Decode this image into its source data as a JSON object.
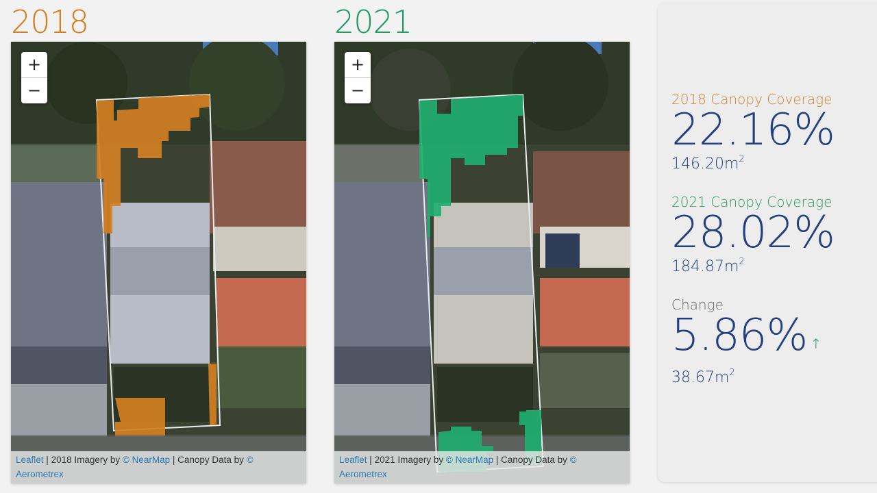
{
  "maps": [
    {
      "year": "2018",
      "accent": "#d27f22",
      "zoom_in": "+",
      "zoom_out": "−",
      "attribution": {
        "leaflet": "Leaflet",
        "sep1": " | ",
        "imagery_text": "2018 Imagery by ",
        "nearmap": "© NearMap",
        "sep2": " | Canopy Data by ",
        "aerometrex": "© Aerometrex"
      }
    },
    {
      "year": "2021",
      "accent": "#1f9a64",
      "zoom_in": "+",
      "zoom_out": "−",
      "attribution": {
        "leaflet": "Leaflet",
        "sep1": " | ",
        "imagery_text": "2021 Imagery by ",
        "nearmap": "© NearMap",
        "sep2": " | Canopy Data by ",
        "aerometrex": "© Aerometrex"
      }
    }
  ],
  "stats": {
    "coverage_2018": {
      "label": "2018 Canopy Coverage",
      "percent": "22.16%",
      "area": "146.20m",
      "unit_sup": "2"
    },
    "coverage_2021": {
      "label": "2021 Canopy Coverage",
      "percent": "28.02%",
      "area": "184.87m",
      "unit_sup": "2"
    },
    "change": {
      "label": "Change",
      "percent": "5.86%",
      "direction_icon": "↑",
      "area": "38.67m",
      "unit_sup": "2"
    }
  },
  "colors": {
    "canopy_2018": "#d27f22",
    "canopy_2021": "#1f9a64",
    "stat_value": "#233f80"
  }
}
